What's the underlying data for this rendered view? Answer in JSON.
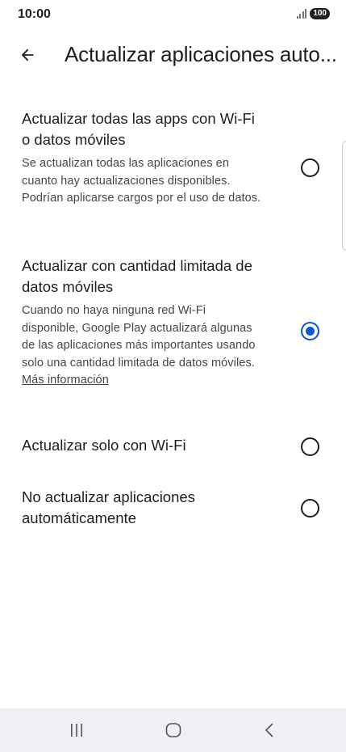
{
  "status_bar": {
    "time": "10:00",
    "battery": "100",
    "signal_icon": "signal-bars-icon"
  },
  "app_bar": {
    "back_icon": "arrow-back-icon",
    "title": "Actualizar aplicaciones auto..."
  },
  "options": [
    {
      "title": "Actualizar todas las apps con Wi-Fi o datos móviles",
      "description": "Se actualizan todas las aplicaciones en cuanto hay actualizaciones disponibles. Podrían aplicarse cargos por el uso de datos.",
      "selected": false
    },
    {
      "title": "Actualizar con cantidad limitada de datos móviles",
      "description": "Cuando no haya ninguna red Wi-Fi disponible, Google Play actualizará algunas de las aplicaciones más importantes usando solo una cantidad limitada de datos móviles.",
      "link": "Más información",
      "selected": true
    },
    {
      "title": "Actualizar solo con Wi-Fi",
      "selected": false
    },
    {
      "title": "No actualizar aplicaciones automáticamente",
      "selected": false
    }
  ],
  "nav_bar": {
    "recents_icon": "recent-apps-icon",
    "home_icon": "home-icon",
    "back_icon": "nav-back-icon"
  },
  "colors": {
    "accent": "#0b57d0",
    "text": "#1f1f1f",
    "secondary_text": "#444746",
    "nav_bar_bg": "#eef0f6"
  }
}
